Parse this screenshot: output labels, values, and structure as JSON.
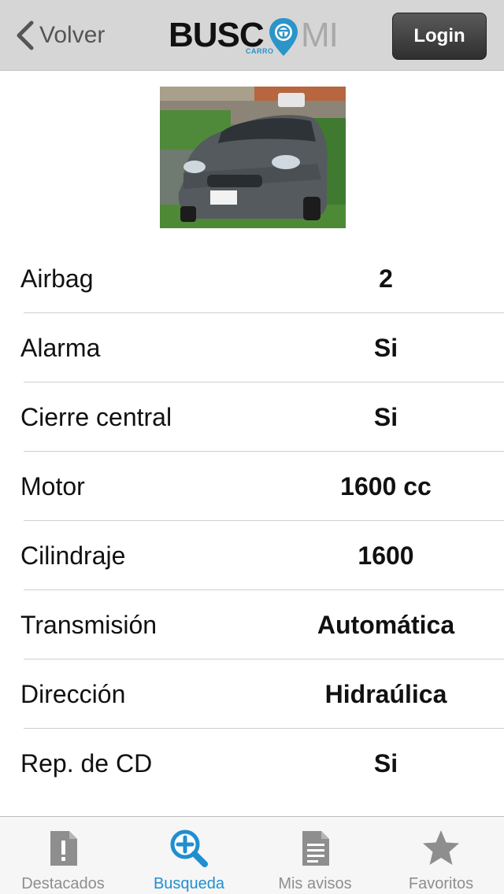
{
  "header": {
    "back_label": "Volver",
    "logo": {
      "main": "BUSC",
      "tail": "MI",
      "sub": "CARRO"
    },
    "login_label": "Login",
    "accent": "#2b94c9"
  },
  "specs": [
    {
      "label": "Airbag",
      "value": "2"
    },
    {
      "label": "Alarma",
      "value": "Si"
    },
    {
      "label": "Cierre central",
      "value": "Si"
    },
    {
      "label": "Motor",
      "value": "1600 cc"
    },
    {
      "label": "Cilindraje",
      "value": "1600"
    },
    {
      "label": "Transmisión",
      "value": "Automática"
    },
    {
      "label": "Dirección",
      "value": "Hidraúlica"
    },
    {
      "label": "Rep. de CD",
      "value": "Si"
    }
  ],
  "tabs": [
    {
      "label": "Destacados",
      "icon": "featured-icon",
      "active": false
    },
    {
      "label": "Busqueda",
      "icon": "search-plus-icon",
      "active": true
    },
    {
      "label": "Mis avisos",
      "icon": "document-icon",
      "active": false
    },
    {
      "label": "Favoritos",
      "icon": "star-icon",
      "active": false
    }
  ],
  "colors": {
    "active_tab": "#1f8fd0",
    "inactive_tab": "#8e8e8e",
    "topbar": "#d6d6d6"
  }
}
